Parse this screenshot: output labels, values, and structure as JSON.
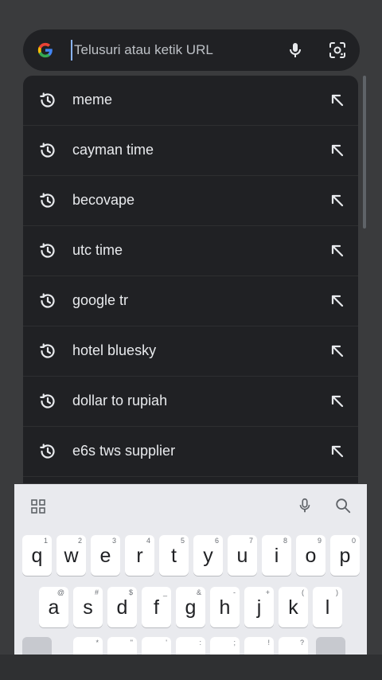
{
  "search": {
    "placeholder": "Telusuri atau ketik URL"
  },
  "suggestions": [
    {
      "text": "meme"
    },
    {
      "text": "cayman time"
    },
    {
      "text": "becovape"
    },
    {
      "text": "utc time"
    },
    {
      "text": "google tr"
    },
    {
      "text": "hotel bluesky"
    },
    {
      "text": "dollar to rupiah"
    },
    {
      "text": "e6s tws supplier"
    }
  ],
  "keyboard": {
    "row1": [
      {
        "k": "q",
        "h": "1"
      },
      {
        "k": "w",
        "h": "2"
      },
      {
        "k": "e",
        "h": "3"
      },
      {
        "k": "r",
        "h": "4"
      },
      {
        "k": "t",
        "h": "5"
      },
      {
        "k": "y",
        "h": "6"
      },
      {
        "k": "u",
        "h": "7"
      },
      {
        "k": "i",
        "h": "8"
      },
      {
        "k": "o",
        "h": "9"
      },
      {
        "k": "p",
        "h": "0"
      }
    ],
    "row2": [
      {
        "k": "a",
        "h": "@"
      },
      {
        "k": "s",
        "h": "#"
      },
      {
        "k": "d",
        "h": "$"
      },
      {
        "k": "f",
        "h": "_"
      },
      {
        "k": "g",
        "h": "&"
      },
      {
        "k": "h",
        "h": "-"
      },
      {
        "k": "j",
        "h": "+"
      },
      {
        "k": "k",
        "h": "("
      },
      {
        "k": "l",
        "h": ")"
      }
    ],
    "row3_hints": [
      "*",
      "\"",
      "'",
      ":",
      ";",
      "!",
      "?"
    ]
  },
  "colors": {
    "background": "#3a3b3d",
    "surface": "#202124",
    "text": "#e8eaed",
    "keyboard": "#e9eaee",
    "cursor": "#8ab4f8"
  }
}
